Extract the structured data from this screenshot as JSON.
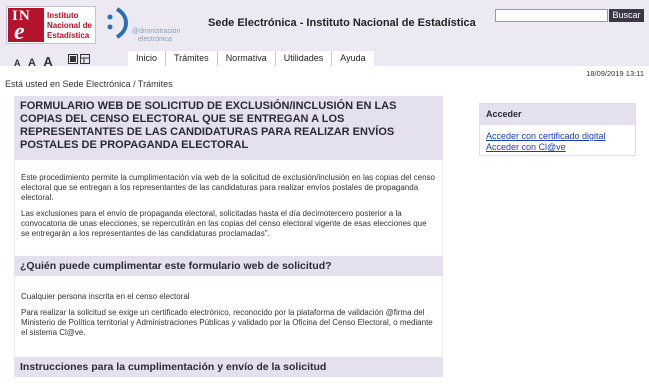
{
  "header": {
    "logo": {
      "ine_mark": "INE",
      "line1": "Instituto",
      "line2": "Nacional de",
      "line3": "Estadística"
    },
    "ae_logo": {
      "line1": "@dministración",
      "line2": "electrónica"
    },
    "title": "Sede Electrónica - Instituto Nacional de Estadística",
    "search": {
      "value": "",
      "placeholder": "",
      "button": "Buscar"
    },
    "text_size": [
      "A",
      "A",
      "A"
    ]
  },
  "nav": {
    "items": [
      "Inicio",
      "Trámites",
      "Normativa",
      "Utilidades",
      "Ayuda"
    ]
  },
  "breadcrumb": "Está usted en Sede Electrónica / Trámites",
  "date": "18/09/2019 13:11",
  "main": {
    "title": "FORMULARIO WEB DE SOLICITUD DE EXCLUSIÓN/INCLUSIÓN EN LAS COPIAS DEL CENSO ELECTORAL QUE SE ENTREGAN A LOS REPRESENTANTES DE LAS CANDIDATURAS PARA REALIZAR ENVÍOS POSTALES DE PROPAGANDA ELECTORAL",
    "intro_p1": "Este procedimiento permite la cumplimentación vía web de la solicitud de exclusión/inclusión en las copias del censo electoral que se entregan a los representantes de las candidaturas para realizar envíos postales de propaganda electoral.",
    "intro_p2": "Las exclusiones para el envío de propaganda electoral, solicitadas hasta el día decimotercero posterior a la convocatoria de unas elecciones, se repercutirán en las copias del censo electoral vigente de esas elecciones que se entregarán a los representantes de las candidaturas proclamadas\".",
    "section1_title": "¿Quién puede cumplimentar este formulario web de solicitud?",
    "section1_p1": "Cualquier persona inscrita en el censo electoral",
    "section1_p2": "Para realizar la solicitud se exige un certificado electrónico, reconocido por la plataforma de validación @firma del Ministerio de Política territorial y Administraciones Públicas y validado por la Oficina del Censo Electoral, o mediante el sistema Cl@ve.",
    "section2_title": "Instrucciones para la cumplimentación y envío de la solicitud"
  },
  "sidebar": {
    "title": "Acceder",
    "links": [
      "Acceder con certificado digital",
      "Acceder con Cl@ve"
    ]
  },
  "colors": {
    "ine_red": "#b5122c",
    "header_bg": "#ece9f3",
    "box_bg": "#e4e0ee",
    "link": "#1a3fa8",
    "search_button": "#3c3646"
  }
}
